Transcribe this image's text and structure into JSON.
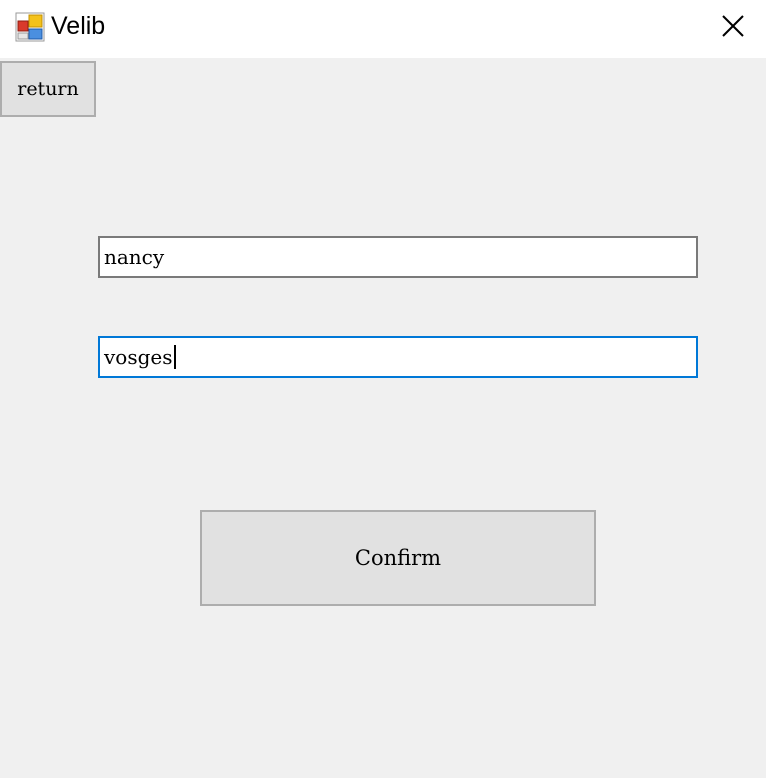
{
  "window": {
    "title": "Velib",
    "icon": "app-window-icon",
    "close_icon": "close-icon"
  },
  "buttons": {
    "return_label": "return",
    "confirm_label": "Confirm"
  },
  "fields": {
    "city_value": "nancy",
    "street_value": "vosges"
  },
  "colors": {
    "focus_border": "#0078d7",
    "field_border": "#7a7a7a",
    "button_bg": "#e1e1e1",
    "client_bg": "#f0f0f0"
  }
}
